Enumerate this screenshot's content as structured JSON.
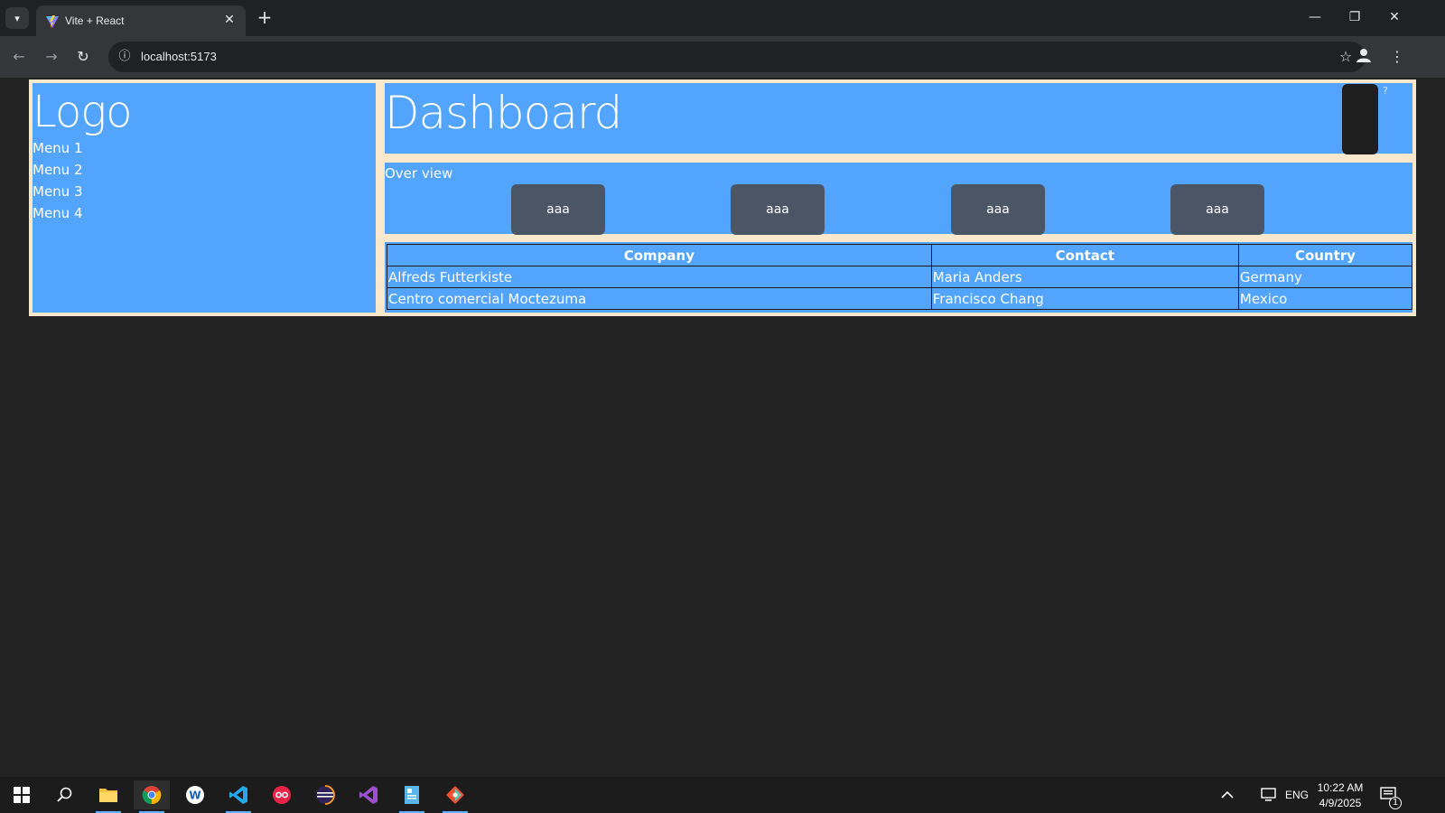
{
  "browser": {
    "tab_title": "Vite + React",
    "url": "localhost:5173",
    "new_tab_icon": "plus-icon",
    "close_icon": "close-icon"
  },
  "sidebar": {
    "logo": "Logo",
    "items": [
      {
        "label": "Menu 1"
      },
      {
        "label": "Menu 2"
      },
      {
        "label": "Menu 3"
      },
      {
        "label": "Menu 4"
      }
    ]
  },
  "header": {
    "title": "Dashboard",
    "help": "?"
  },
  "overview": {
    "label": "Over view",
    "cards": [
      {
        "label": "aaa"
      },
      {
        "label": "aaa"
      },
      {
        "label": "aaa"
      },
      {
        "label": "aaa"
      }
    ]
  },
  "table": {
    "headers": [
      "Company",
      "Contact",
      "Country"
    ],
    "rows": [
      [
        "Alfreds Futterkiste",
        "Maria Anders",
        "Germany"
      ],
      [
        "Centro comercial Moctezuma",
        "Francisco Chang",
        "Mexico"
      ]
    ]
  },
  "taskbar": {
    "language": "ENG",
    "time": "10:22 AM",
    "date": "4/9/2025",
    "notification_count": "1"
  },
  "colors": {
    "panel_blue": "#52a4fd",
    "frame_cream": "#fae8cd",
    "card_gray": "#4a5566",
    "page_bg": "#232323"
  }
}
